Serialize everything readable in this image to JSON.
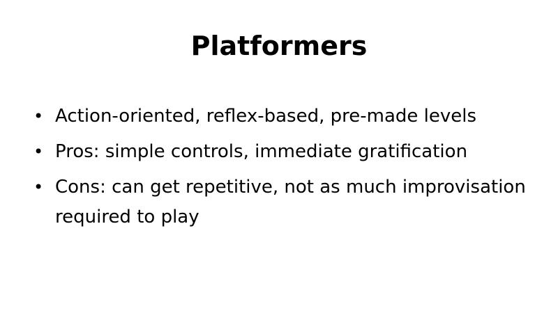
{
  "slide": {
    "title": "Platformers",
    "bullet_symbol": "•",
    "bullets": [
      {
        "text": "Action-oriented, reflex-based, pre-made levels"
      },
      {
        "text": "Pros: simple controls, immediate gratification"
      },
      {
        "text": "Cons: can get repetitive, not as much improvisation required to play"
      }
    ]
  }
}
